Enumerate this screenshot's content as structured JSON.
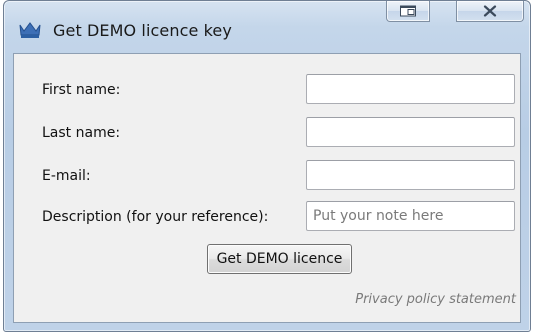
{
  "window": {
    "title": "Get DEMO licence key",
    "icon": "crown-icon",
    "controls": {
      "restore_icon": "restore-window-icon",
      "close_glyph": "✕"
    }
  },
  "form": {
    "fields": [
      {
        "label": "First name:",
        "value": "",
        "placeholder": ""
      },
      {
        "label": "Last name:",
        "value": "",
        "placeholder": ""
      },
      {
        "label": "E-mail:",
        "value": "",
        "placeholder": ""
      },
      {
        "label": "Description (for your reference):",
        "value": "",
        "placeholder": "Put your note here"
      }
    ],
    "submit_label": "Get DEMO licence",
    "privacy_link": "Privacy policy statement"
  },
  "colors": {
    "accent": "#3d6fb6",
    "frame": "#bfd2e8",
    "client_bg": "#f0f0f0",
    "link_text": "#7a7a7a"
  }
}
